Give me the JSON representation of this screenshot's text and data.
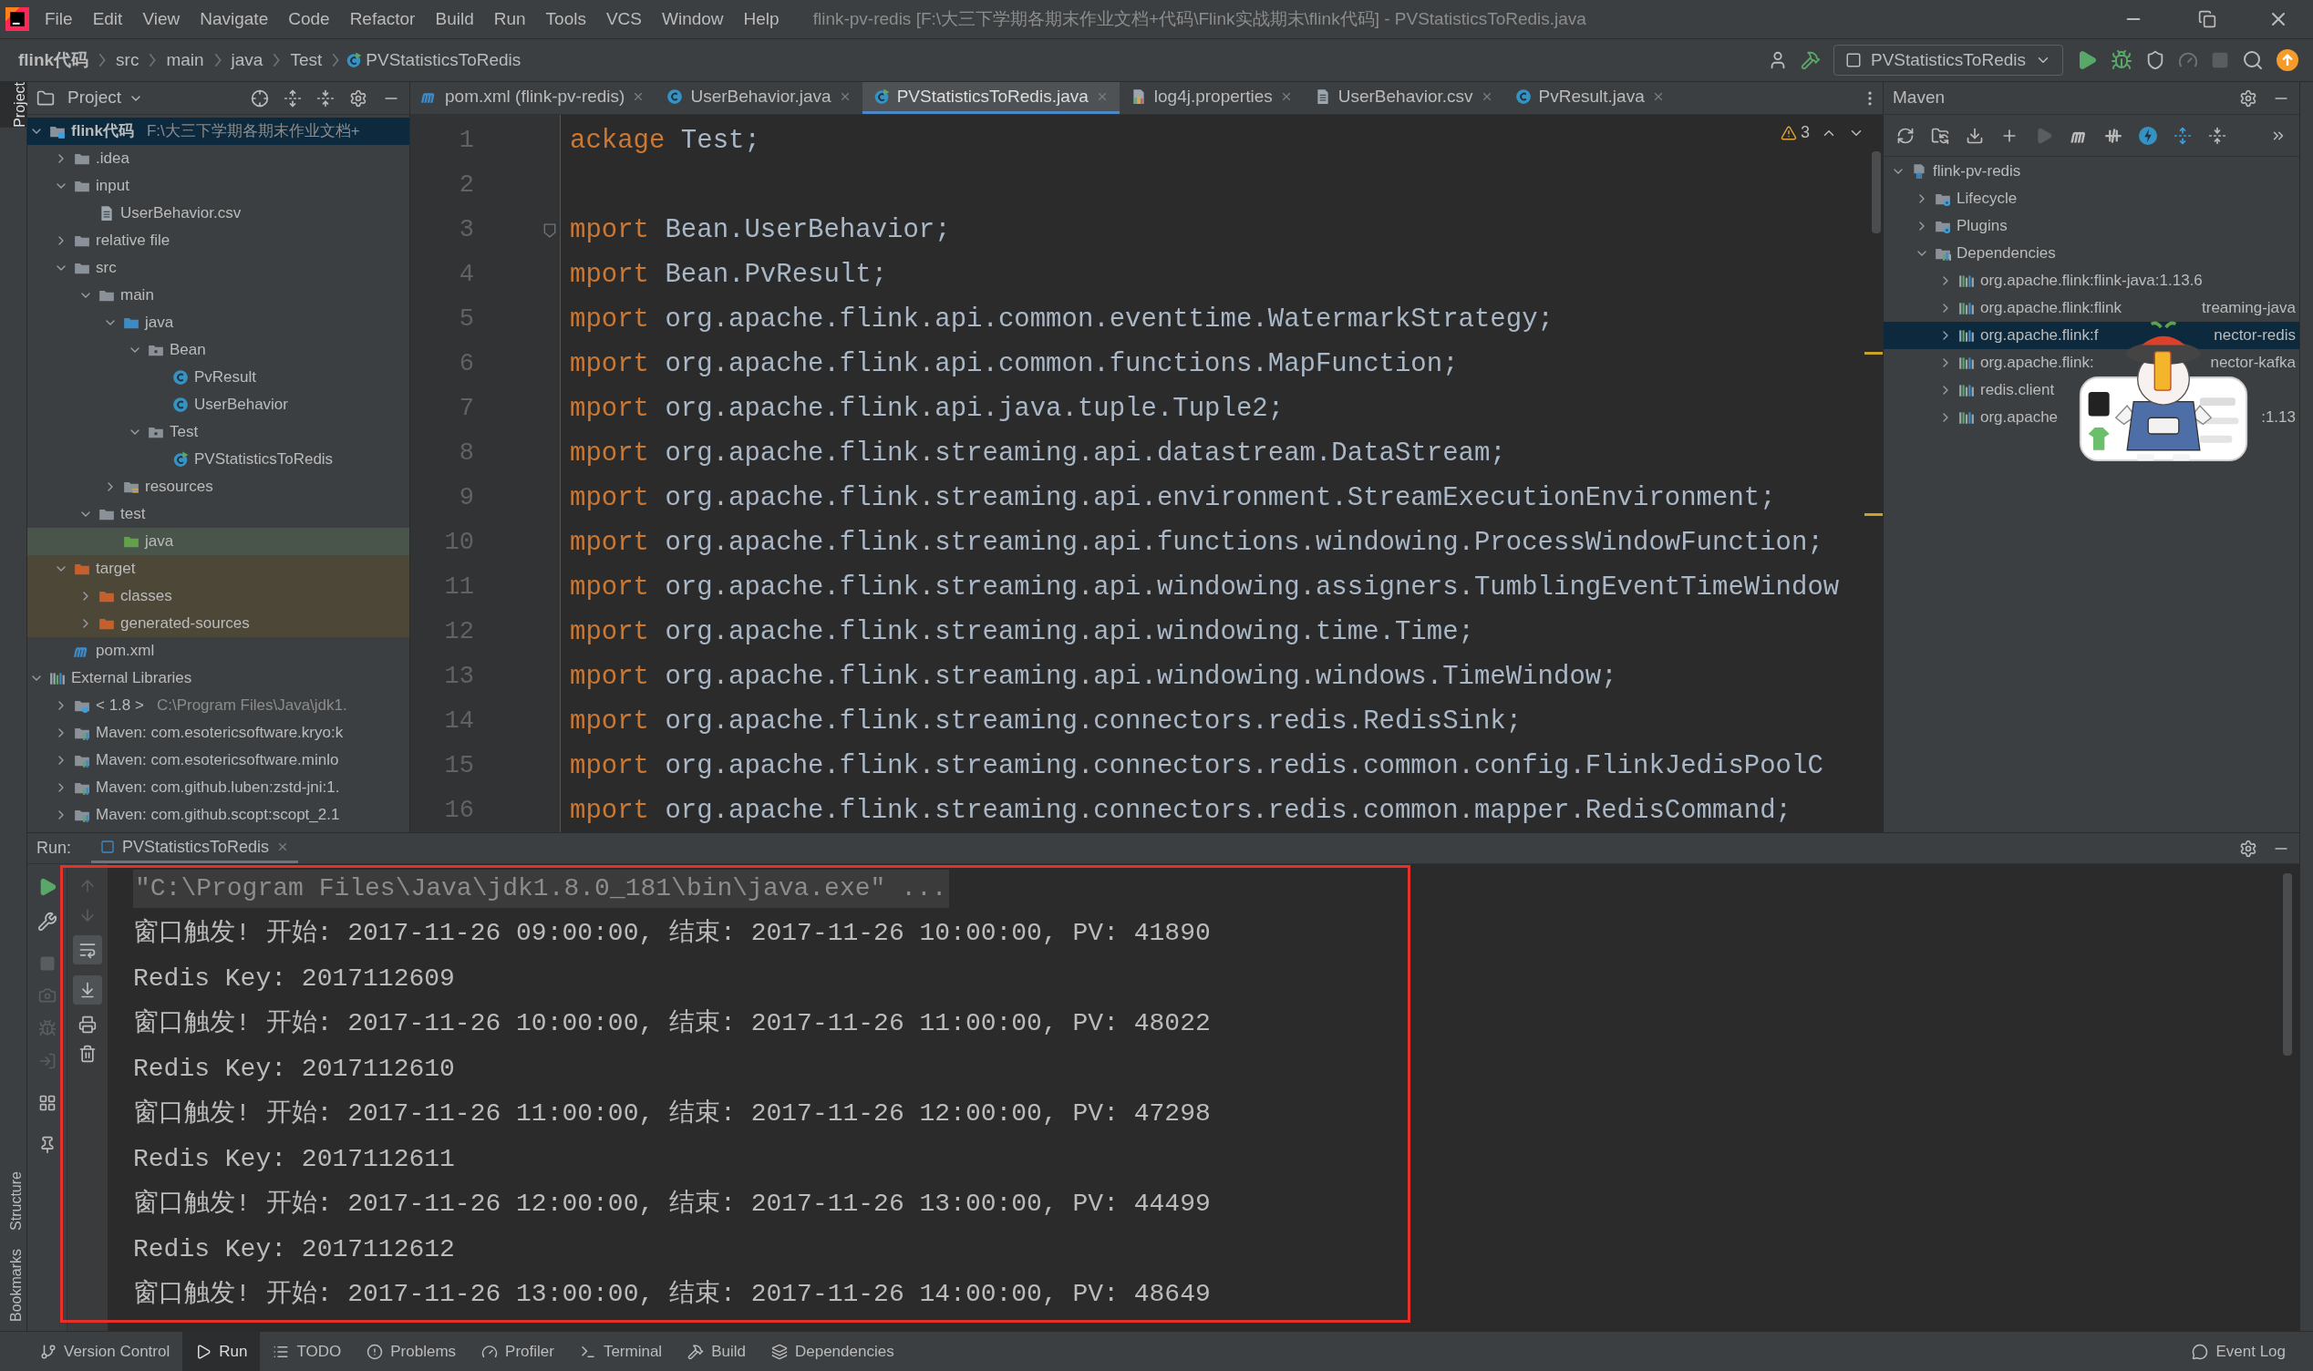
{
  "menu": [
    "File",
    "Edit",
    "View",
    "Navigate",
    "Code",
    "Refactor",
    "Build",
    "Run",
    "Tools",
    "VCS",
    "Window",
    "Help"
  ],
  "window_title": "flink-pv-redis [F:\\大三下学期各期末作业文档+代码\\Flink实战期末\\flink代码] - PVStatisticsToRedis.java",
  "breadcrumbs": [
    "flink代码",
    "src",
    "main",
    "java",
    "Test",
    "PVStatisticsToRedis"
  ],
  "run_config": "PVStatisticsToRedis",
  "left_stripe": {
    "top": [
      {
        "label": "Project",
        "selected": true
      }
    ],
    "bottom": [
      {
        "label": "Structure",
        "selected": false
      },
      {
        "label": "Bookmarks",
        "selected": false
      }
    ]
  },
  "project_panel": {
    "title": "Project",
    "tree": [
      {
        "label": "flink代码",
        "kind": "module",
        "expanded": true,
        "selected": true,
        "hint": "F:\\大三下学期各期末作业文档+",
        "children": [
          {
            "label": ".idea",
            "kind": "folder",
            "expanded": false,
            "selected": false
          },
          {
            "label": "input",
            "kind": "folder",
            "expanded": true,
            "selected": false,
            "children": [
              {
                "label": "UserBehavior.csv",
                "kind": "text_file",
                "selected": false
              }
            ]
          },
          {
            "label": "relative file",
            "kind": "folder",
            "expanded": false,
            "selected": false
          },
          {
            "label": "src",
            "kind": "folder",
            "expanded": true,
            "selected": false,
            "children": [
              {
                "label": "main",
                "kind": "folder",
                "expanded": true,
                "selected": false,
                "children": [
                  {
                    "label": "java",
                    "kind": "source_root",
                    "expanded": true,
                    "selected": false,
                    "children": [
                      {
                        "label": "Bean",
                        "kind": "package",
                        "expanded": true,
                        "selected": false,
                        "children": [
                          {
                            "label": "PvResult",
                            "kind": "class",
                            "selected": false
                          },
                          {
                            "label": "UserBehavior",
                            "kind": "class",
                            "selected": false
                          }
                        ]
                      },
                      {
                        "label": "Test",
                        "kind": "package",
                        "expanded": true,
                        "selected": false,
                        "children": [
                          {
                            "label": "PVStatisticsToRedis",
                            "kind": "main_class",
                            "selected": false
                          }
                        ]
                      }
                    ]
                  },
                  {
                    "label": "resources",
                    "kind": "resources",
                    "expanded": false,
                    "selected": false
                  }
                ]
              },
              {
                "label": "test",
                "kind": "folder",
                "expanded": true,
                "selected": false,
                "children": [
                  {
                    "label": "java",
                    "kind": "test_root",
                    "selected": false
                  }
                ]
              }
            ]
          },
          {
            "label": "target",
            "kind": "excluded",
            "expanded": true,
            "selected": false,
            "children": [
              {
                "label": "classes",
                "kind": "excluded",
                "expanded": false,
                "selected": false
              },
              {
                "label": "generated-sources",
                "kind": "excluded",
                "expanded": false,
                "selected": false
              }
            ]
          },
          {
            "label": "pom.xml",
            "kind": "maven_file",
            "selected": false
          }
        ]
      },
      {
        "label": "External Libraries",
        "kind": "libraries",
        "expanded": true,
        "selected": false,
        "children": [
          {
            "label": "< 1.8 >",
            "kind": "jdk",
            "expanded": false,
            "selected": false,
            "hint": "C:\\Program Files\\Java\\jdk1."
          },
          {
            "label": "Maven: com.esotericsoftware.kryo:k",
            "kind": "library",
            "expanded": false,
            "selected": false
          },
          {
            "label": "Maven: com.esotericsoftware.minlo",
            "kind": "library",
            "expanded": false,
            "selected": false
          },
          {
            "label": "Maven: com.github.luben:zstd-jni:1.",
            "kind": "library",
            "expanded": false,
            "selected": false
          },
          {
            "label": "Maven: com.github.scopt:scopt_2.1",
            "kind": "library",
            "expanded": false,
            "selected": false
          }
        ]
      }
    ]
  },
  "editor": {
    "tabs": [
      {
        "label": "pom.xml (flink-pv-redis)",
        "kind": "maven_file",
        "selected": false
      },
      {
        "label": "UserBehavior.java",
        "kind": "class",
        "selected": false
      },
      {
        "label": "PVStatisticsToRedis.java",
        "kind": "main_class",
        "selected": true
      },
      {
        "label": "log4j.properties",
        "kind": "properties",
        "selected": false
      },
      {
        "label": "UserBehavior.csv",
        "kind": "text_file",
        "selected": false
      },
      {
        "label": "PvResult.java",
        "kind": "class",
        "selected": false
      }
    ],
    "warnings": "3",
    "lines": [
      {
        "number": "1",
        "keyword": "ackage",
        "code": " Test;",
        "fold": false
      },
      {
        "number": "2",
        "fold": false
      },
      {
        "number": "3",
        "keyword": "mport",
        "code": " Bean.UserBehavior;",
        "fold": true
      },
      {
        "number": "4",
        "keyword": "mport",
        "code": " Bean.PvResult;",
        "fold": false
      },
      {
        "number": "5",
        "keyword": "mport",
        "code": " org.apache.flink.api.common.eventtime.WatermarkStrategy;",
        "fold": false
      },
      {
        "number": "6",
        "keyword": "mport",
        "code": " org.apache.flink.api.common.functions.MapFunction;",
        "fold": false
      },
      {
        "number": "7",
        "keyword": "mport",
        "code": " org.apache.flink.api.java.tuple.Tuple2;",
        "fold": false
      },
      {
        "number": "8",
        "keyword": "mport",
        "code": " org.apache.flink.streaming.api.datastream.DataStream;",
        "fold": false
      },
      {
        "number": "9",
        "keyword": "mport",
        "code": " org.apache.flink.streaming.api.environment.StreamExecutionEnvironment;",
        "fold": false
      },
      {
        "number": "10",
        "keyword": "mport",
        "code": " org.apache.flink.streaming.api.functions.windowing.ProcessWindowFunction;",
        "fold": false
      },
      {
        "number": "11",
        "keyword": "mport",
        "code": " org.apache.flink.streaming.api.windowing.assigners.TumblingEventTimeWindow",
        "fold": false
      },
      {
        "number": "12",
        "keyword": "mport",
        "code": " org.apache.flink.streaming.api.windowing.time.Time;",
        "fold": false
      },
      {
        "number": "13",
        "keyword": "mport",
        "code": " org.apache.flink.streaming.api.windowing.windows.TimeWindow;",
        "fold": false
      },
      {
        "number": "14",
        "keyword": "mport",
        "code": " org.apache.flink.streaming.connectors.redis.RedisSink;",
        "fold": false
      },
      {
        "number": "15",
        "keyword": "mport",
        "code": " org.apache.flink.streaming.connectors.redis.common.config.FlinkJedisPoolC",
        "fold": false
      },
      {
        "number": "16",
        "keyword": "mport",
        "code": " org.apache.flink.streaming.connectors.redis.common.mapper.RedisCommand;",
        "fold": false
      }
    ]
  },
  "maven": {
    "title": "Maven",
    "tree": [
      {
        "label": "flink-pv-redis",
        "kind": "maven_project",
        "expanded": true,
        "selected": false,
        "children": [
          {
            "label": "Lifecycle",
            "kind": "lifecycle",
            "expanded": false,
            "selected": false
          },
          {
            "label": "Plugins",
            "kind": "lifecycle",
            "expanded": false,
            "selected": false
          },
          {
            "label": "Dependencies",
            "kind": "dependencies",
            "expanded": true,
            "selected": false,
            "children": [
              {
                "label": "org.apache.flink:flink-java:1.13.6",
                "kind": "dependency",
                "expanded": false,
                "selected": false
              },
              {
                "label": "org.apache.flink:flink",
                "tail": "treaming-java",
                "kind": "dependency",
                "expanded": false,
                "selected": false
              },
              {
                "label": "org.apache.flink:f",
                "tail": "nector-redis",
                "kind": "dependency",
                "expanded": false,
                "selected": true
              },
              {
                "label": "org.apache.flink:",
                "tail": "nector-kafka",
                "kind": "dependency",
                "expanded": false,
                "selected": false
              },
              {
                "label": "redis.client",
                "kind": "dependency",
                "expanded": false,
                "selected": false
              },
              {
                "label": "org.apache",
                "tail": ":1.13",
                "kind": "dependency",
                "expanded": false,
                "selected": false
              }
            ]
          }
        ]
      }
    ]
  },
  "run": {
    "label": "Run:",
    "tab": "PVStatisticsToRedis",
    "console": [
      {
        "kind": "command",
        "text": "\"C:\\Program Files\\Java\\jdk1.8.0_181\\bin\\java.exe\" ..."
      },
      {
        "kind": "output",
        "text": "窗口触发! 开始: 2017-11-26 09:00:00, 结束: 2017-11-26 10:00:00, PV: 41890"
      },
      {
        "kind": "output",
        "text": "Redis Key: 2017112609"
      },
      {
        "kind": "output",
        "text": "窗口触发! 开始: 2017-11-26 10:00:00, 结束: 2017-11-26 11:00:00, PV: 48022"
      },
      {
        "kind": "output",
        "text": "Redis Key: 2017112610"
      },
      {
        "kind": "output",
        "text": "窗口触发! 开始: 2017-11-26 11:00:00, 结束: 2017-11-26 12:00:00, PV: 47298"
      },
      {
        "kind": "output",
        "text": "Redis Key: 2017112611"
      },
      {
        "kind": "output",
        "text": "窗口触发! 开始: 2017-11-26 12:00:00, 结束: 2017-11-26 13:00:00, PV: 44499"
      },
      {
        "kind": "output",
        "text": "Redis Key: 2017112612"
      },
      {
        "kind": "output",
        "text": "窗口触发! 开始: 2017-11-26 13:00:00, 结束: 2017-11-26 14:00:00, PV: 48649"
      }
    ]
  },
  "status_bar": {
    "items": [
      {
        "label": "Version Control",
        "kind": "vcs",
        "selected": false
      },
      {
        "label": "Run",
        "kind": "run",
        "selected": true
      },
      {
        "label": "TODO",
        "kind": "todo",
        "selected": false
      },
      {
        "label": "Problems",
        "kind": "problems",
        "selected": false
      },
      {
        "label": "Profiler",
        "kind": "profiler",
        "selected": false
      },
      {
        "label": "Terminal",
        "kind": "terminal",
        "selected": false
      },
      {
        "label": "Build",
        "kind": "build",
        "selected": false
      },
      {
        "label": "Dependencies",
        "kind": "dependencies",
        "selected": false
      }
    ],
    "event_log": "Event Log"
  }
}
